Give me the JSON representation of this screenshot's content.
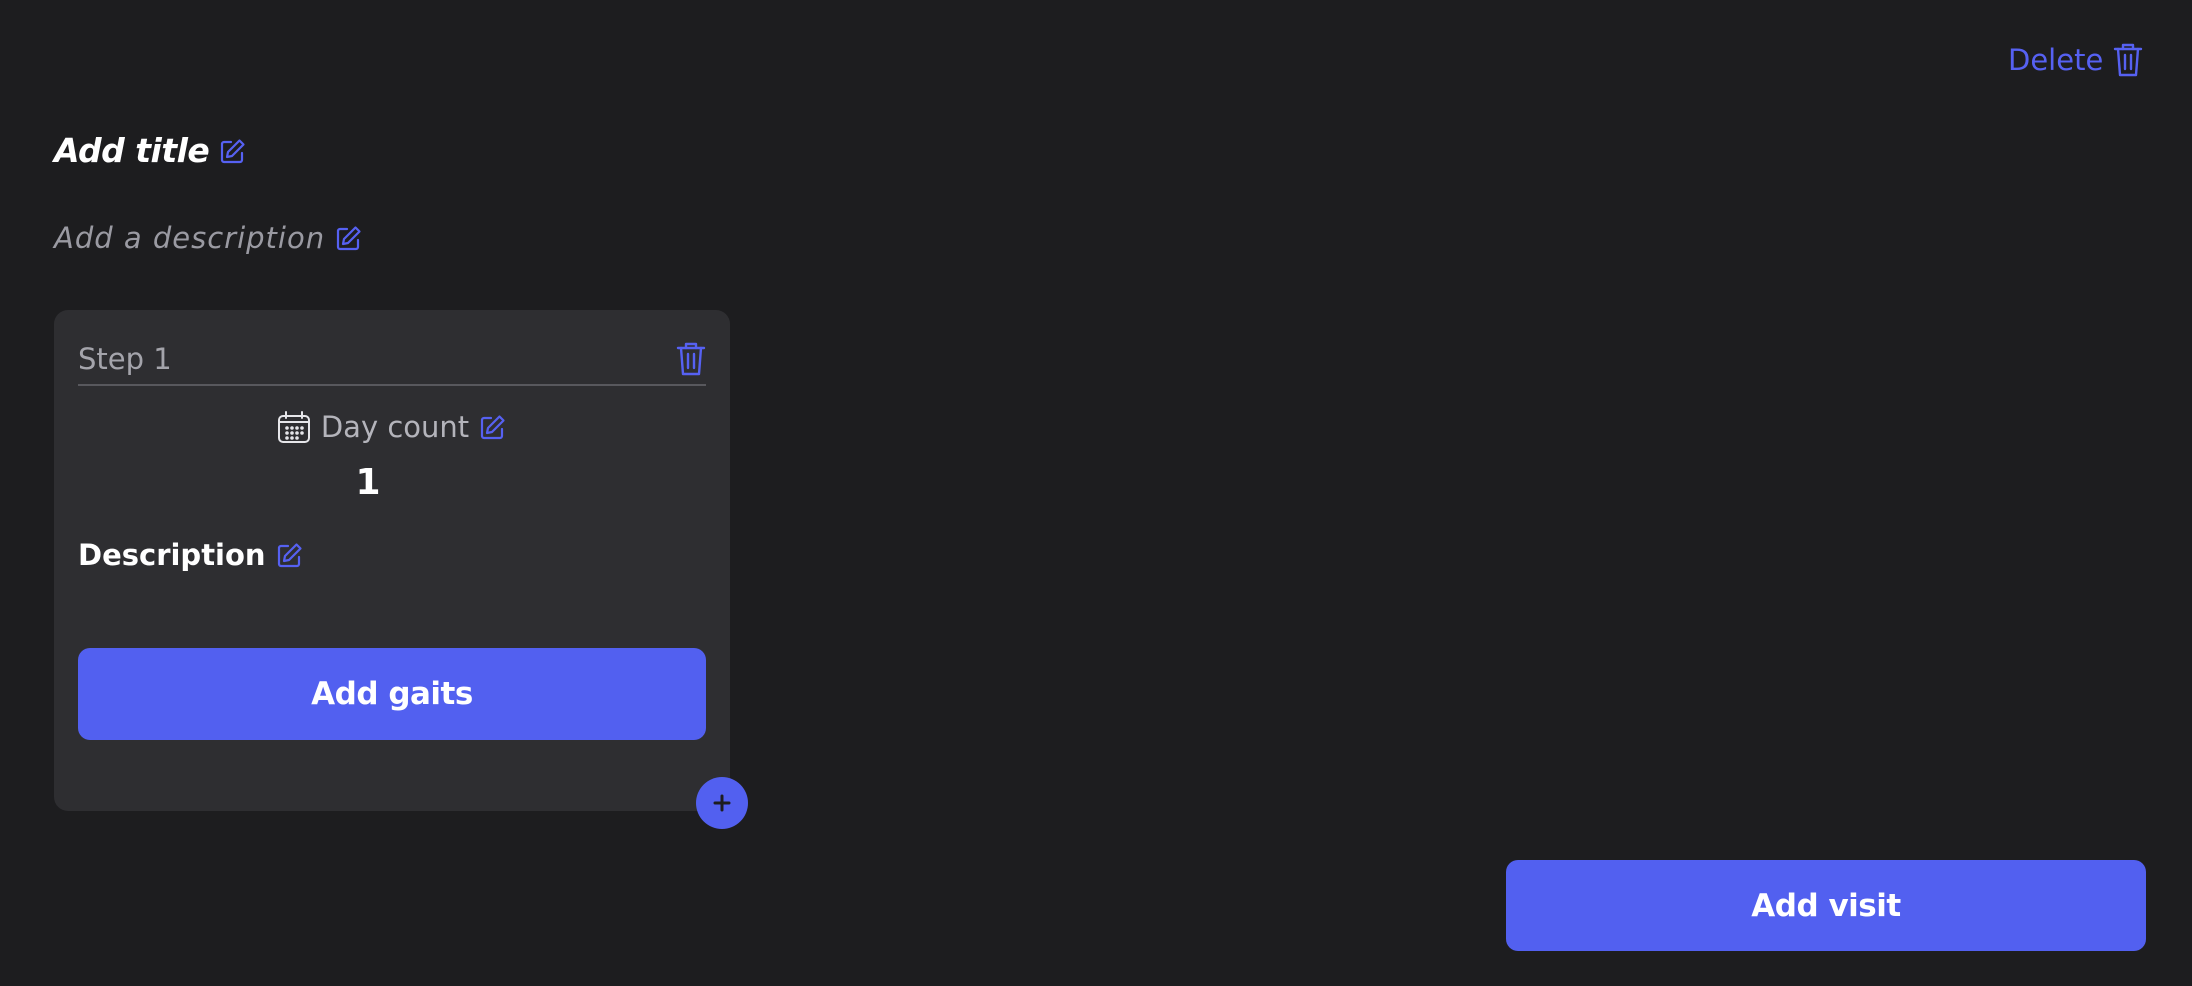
{
  "header": {
    "delete_label": "Delete",
    "delete_icon": "trash-icon"
  },
  "plan": {
    "title_placeholder": "Add title",
    "description_placeholder": "Add a description",
    "edit_icon": "pencil-square-icon"
  },
  "step": {
    "label": "Step 1",
    "day_count_label": "Day count",
    "day_count_icon": "calendar-icon",
    "day_count_value": "1",
    "description_label": "Description",
    "add_gaits_label": "Add gaits",
    "add_step_icon": "plus-icon"
  },
  "footer": {
    "add_visit_label": "Add visit"
  },
  "colors": {
    "background": "#1d1d1f",
    "card": "#2e2e31",
    "accent": "#5260f0"
  }
}
